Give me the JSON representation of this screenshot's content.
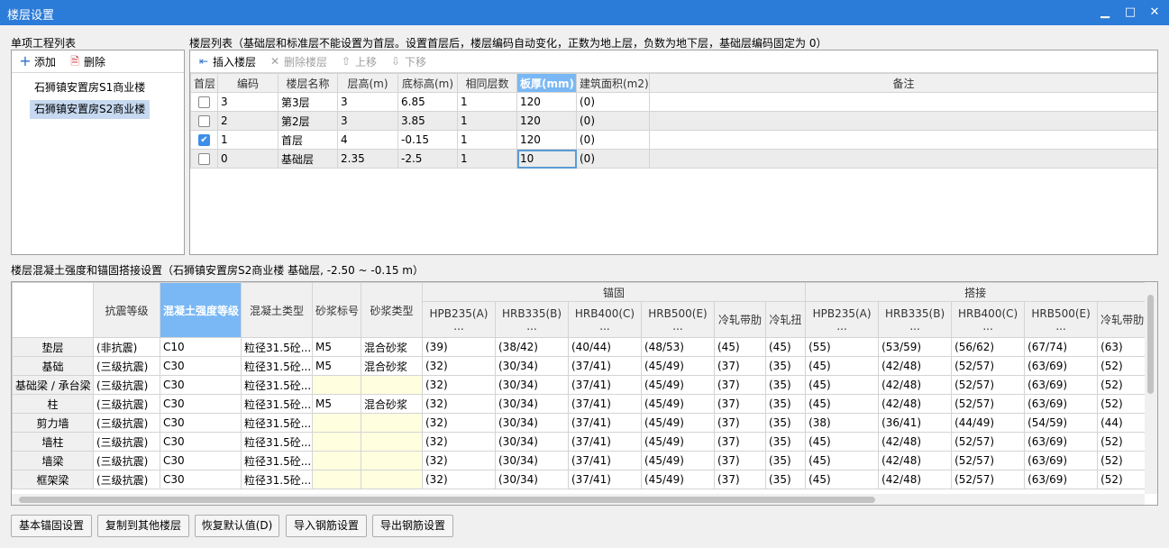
{
  "window": {
    "title": "楼层设置",
    "min": "▁",
    "max": "□",
    "close": "✕"
  },
  "left": {
    "label": "单项工程列表",
    "add": "添加",
    "delete": "删除",
    "items": [
      "石狮镇安置房S1商业楼",
      "石狮镇安置房S2商业楼"
    ],
    "selected": 1
  },
  "floors": {
    "label": "楼层列表（基础层和标准层不能设置为首层。设置首层后，楼层编码自动变化，正数为地上层，负数为地下层，基础层编码固定为 0）",
    "toolbar": {
      "insert": "插入楼层",
      "delete": "删除楼层",
      "up": "上移",
      "down": "下移"
    },
    "headers": [
      "首层",
      "编码",
      "楼层名称",
      "层高(m)",
      "底标高(m)",
      "相同层数",
      "板厚(mm)",
      "建筑面积(m2)",
      "备注"
    ],
    "rows": [
      {
        "first": false,
        "cells": [
          "3",
          "第3层",
          "3",
          "6.85",
          "1",
          "120",
          "(0)",
          ""
        ]
      },
      {
        "first": false,
        "cells": [
          "2",
          "第2层",
          "3",
          "3.85",
          "1",
          "120",
          "(0)",
          ""
        ]
      },
      {
        "first": true,
        "cells": [
          "1",
          "首层",
          "4",
          "-0.15",
          "1",
          "120",
          "(0)",
          ""
        ]
      },
      {
        "first": false,
        "cells": [
          "0",
          "基础层",
          "2.35",
          "-2.5",
          "1",
          "10",
          "(0)",
          ""
        ]
      }
    ]
  },
  "concrete": {
    "label": "楼层混凝土强度和锚固搭接设置（石狮镇安置房S2商业楼  基础层, -2.50 ~ -0.15 m）",
    "groups": {
      "anchor": "锚固",
      "lap": "搭接"
    },
    "headers": [
      "抗震等级",
      "混凝土强度等级",
      "混凝土类型",
      "砂浆标号",
      "砂浆类型"
    ],
    "steel": [
      "HPB235(A)\n...",
      "HRB335(B)\n...",
      "HRB400(C)\n...",
      "HRB500(E)\n...",
      "冷轧带肋",
      "冷轧扭"
    ],
    "lap_steel": [
      "HPB235(A)\n...",
      "HRB335(B)\n...",
      "HRB400(C)\n...",
      "HRB500(E)\n...",
      "冷轧带肋"
    ],
    "rows": [
      {
        "name": "垫层",
        "cells": [
          "(非抗震)",
          "C10",
          "粒径31.5砼...",
          "M5",
          "混合砂浆",
          "(39)",
          "(38/42)",
          "(40/44)",
          "(48/53)",
          "(45)",
          "(45)",
          "(55)",
          "(53/59)",
          "(56/62)",
          "(67/74)",
          "(63)"
        ]
      },
      {
        "name": "基础",
        "cells": [
          "(三级抗震)",
          "C30",
          "粒径31.5砼...",
          "M5",
          "混合砂浆",
          "(32)",
          "(30/34)",
          "(37/41)",
          "(45/49)",
          "(37)",
          "(35)",
          "(45)",
          "(42/48)",
          "(52/57)",
          "(63/69)",
          "(52)"
        ]
      },
      {
        "name": "基础梁 / 承台梁",
        "cells": [
          "(三级抗震)",
          "C30",
          "粒径31.5砼...",
          "",
          "",
          "(32)",
          "(30/34)",
          "(37/41)",
          "(45/49)",
          "(37)",
          "(35)",
          "(45)",
          "(42/48)",
          "(52/57)",
          "(63/69)",
          "(52)"
        ]
      },
      {
        "name": "柱",
        "cells": [
          "(三级抗震)",
          "C30",
          "粒径31.5砼...",
          "M5",
          "混合砂浆",
          "(32)",
          "(30/34)",
          "(37/41)",
          "(45/49)",
          "(37)",
          "(35)",
          "(45)",
          "(42/48)",
          "(52/57)",
          "(63/69)",
          "(52)"
        ]
      },
      {
        "name": "剪力墙",
        "cells": [
          "(三级抗震)",
          "C30",
          "粒径31.5砼...",
          "",
          "",
          "(32)",
          "(30/34)",
          "(37/41)",
          "(45/49)",
          "(37)",
          "(35)",
          "(38)",
          "(36/41)",
          "(44/49)",
          "(54/59)",
          "(44)"
        ]
      },
      {
        "name": "墙柱",
        "cells": [
          "(三级抗震)",
          "C30",
          "粒径31.5砼...",
          "",
          "",
          "(32)",
          "(30/34)",
          "(37/41)",
          "(45/49)",
          "(37)",
          "(35)",
          "(45)",
          "(42/48)",
          "(52/57)",
          "(63/69)",
          "(52)"
        ]
      },
      {
        "name": "墙梁",
        "cells": [
          "(三级抗震)",
          "C30",
          "粒径31.5砼...",
          "",
          "",
          "(32)",
          "(30/34)",
          "(37/41)",
          "(45/49)",
          "(37)",
          "(35)",
          "(45)",
          "(42/48)",
          "(52/57)",
          "(63/69)",
          "(52)"
        ]
      },
      {
        "name": "框架梁",
        "cells": [
          "(三级抗震)",
          "C30",
          "粒径31.5砼...",
          "",
          "",
          "(32)",
          "(30/34)",
          "(37/41)",
          "(45/49)",
          "(37)",
          "(35)",
          "(45)",
          "(42/48)",
          "(52/57)",
          "(63/69)",
          "(52)"
        ]
      }
    ]
  },
  "buttons": [
    "基本锚固设置",
    "复制到其他楼层",
    "恢复默认值(D)",
    "导入钢筋设置",
    "导出钢筋设置"
  ]
}
